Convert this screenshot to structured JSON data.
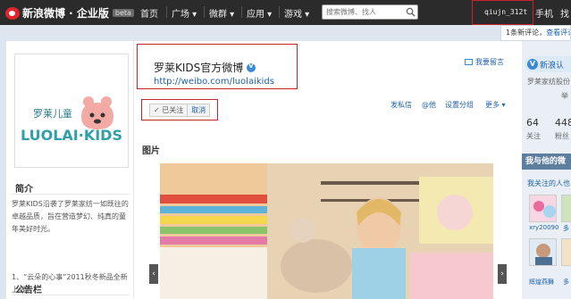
{
  "topbar": {
    "logo": "新浪微博 · 企业版",
    "beta": "beta",
    "nav": [
      "首页",
      "广场 ▾",
      "微群 ▾",
      "应用 ▾",
      "游戏 ▾"
    ],
    "search_placeholder": "搜索微博、找人",
    "username": "qiujn_312t",
    "right_nav": [
      "手机",
      "找"
    ]
  },
  "notification": {
    "text": "1条新评论，",
    "link": "查看评论"
  },
  "profile": {
    "title": "罗莱KIDS官方微博",
    "url": "http://weibo.com/luolaikids",
    "leave_message": "我要留言",
    "follow_status": "✓ 已关注",
    "cancel": "取消",
    "actions": [
      "发私信",
      "@他",
      "设置分组",
      "更多 ▾"
    ],
    "logo_cn": "罗莱儿童",
    "logo_en": "LUOLAI·KIDS"
  },
  "sidebar": {
    "intro_heading": "简介",
    "intro_text": "罗莱KIDS沿袭了罗莱家纺一如既往的卓越品质，旨在营造梦幻、纯真的童年美好时光。",
    "notice_heading": "公告栏",
    "notice_text": "1、“云朵的心事”2011秋冬新品全新上线！"
  },
  "pictures_label": "图片",
  "rightcol": {
    "badge": "新浪认",
    "company": "罗莱家纺股份",
    "region": "举",
    "stat1_num": "64",
    "stat1_label": "关注",
    "stat2_num": "448",
    "stat2_label": "粉丝",
    "header": "我与他的微",
    "link": "我关注的人也",
    "users": [
      "xry20090",
      "多",
      "辉煌燕舞",
      "多"
    ]
  },
  "colors": {
    "topbar": "#2b2b2b",
    "highlight_box": "#c8232c",
    "link": "#1f62aa"
  }
}
